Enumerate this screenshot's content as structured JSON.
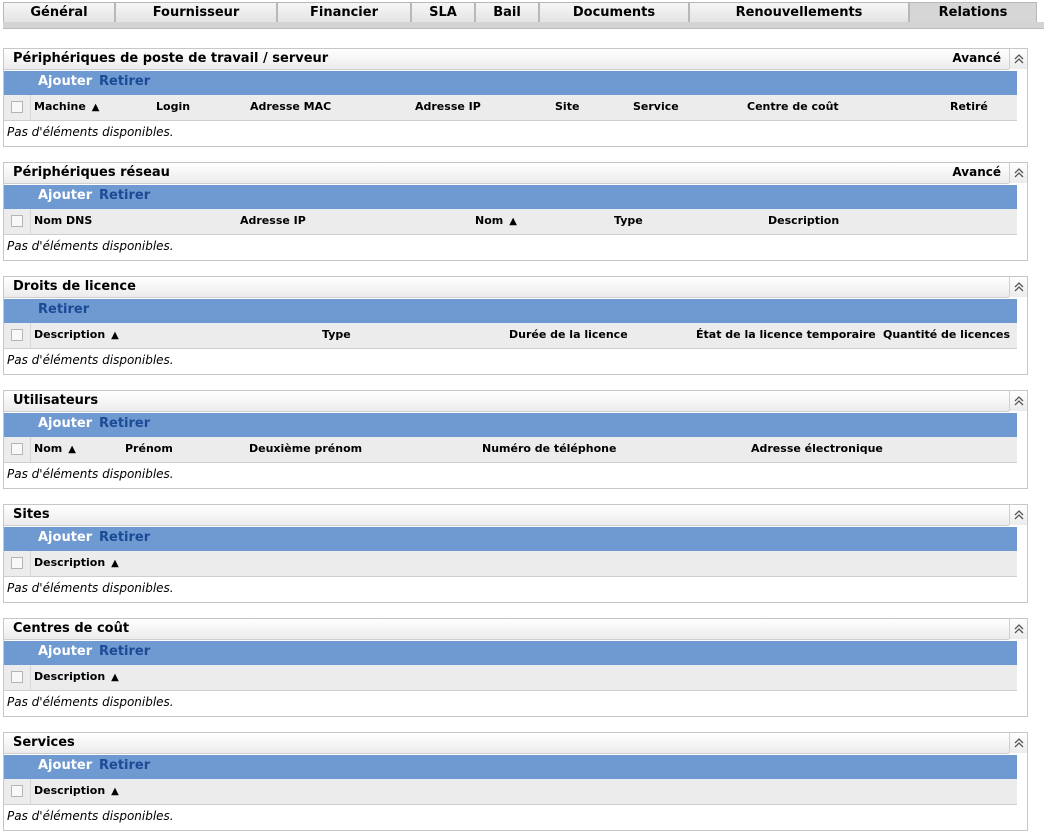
{
  "tabs": [
    {
      "label": "Général"
    },
    {
      "label": "Fournisseur"
    },
    {
      "label": "Financier"
    },
    {
      "label": "SLA"
    },
    {
      "label": "Bail"
    },
    {
      "label": "Documents"
    },
    {
      "label": "Renouvellements"
    },
    {
      "label": "Relations"
    }
  ],
  "common": {
    "add_label": "Ajouter",
    "remove_label": "Retirer",
    "advanced_label": "Avancé",
    "empty_text": "Pas d'éléments disponibles.",
    "sort_glyph": "▲"
  },
  "sections": [
    {
      "title": "Périphériques de poste de travail / serveur",
      "columns": [
        "Machine",
        "Login",
        "Adresse MAC",
        "Adresse IP",
        "Site",
        "Service",
        "Centre de coût",
        "Retiré"
      ]
    },
    {
      "title": "Périphériques réseau",
      "columns": [
        "Nom DNS",
        "Adresse IP",
        "Nom",
        "Type",
        "Description"
      ]
    },
    {
      "title": "Droits de licence",
      "columns": [
        "Description",
        "Type",
        "Durée de la licence",
        "État de la licence temporaire",
        "Quantité de licences"
      ]
    },
    {
      "title": "Utilisateurs",
      "columns": [
        "Nom",
        "Prénom",
        "Deuxième prénom",
        "Numéro de téléphone",
        "Adresse électronique"
      ]
    },
    {
      "title": "Sites",
      "columns": [
        "Description"
      ]
    },
    {
      "title": "Centres de coût",
      "columns": [
        "Description"
      ]
    },
    {
      "title": "Services",
      "columns": [
        "Description"
      ]
    }
  ]
}
